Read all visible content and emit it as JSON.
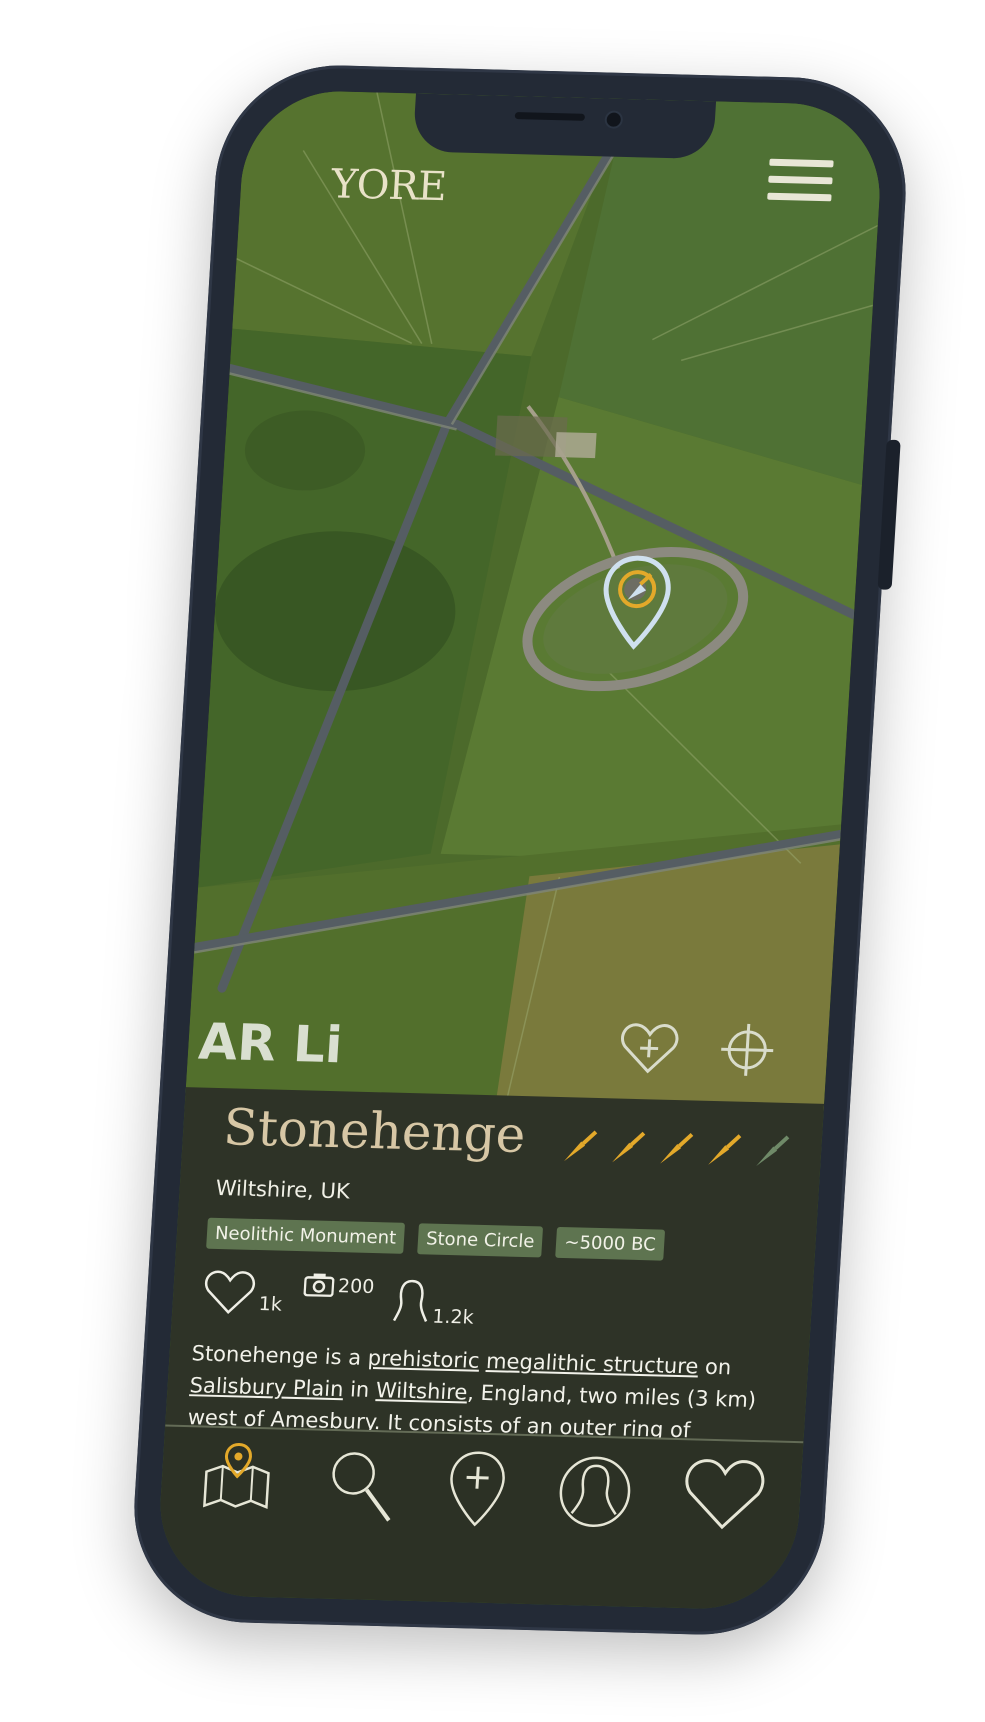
{
  "app": {
    "logo_text": "YORE"
  },
  "map": {
    "ar_label": "AR Li"
  },
  "place": {
    "name": "Stonehenge",
    "region": "Wiltshire, UK",
    "rating": 4,
    "rating_max": 5,
    "tags": [
      "Neolithic Monument",
      "Stone Circle",
      "~5000 BC"
    ],
    "stats": {
      "likes": "1k",
      "photos": "200",
      "visitors": "1.2k"
    },
    "description": {
      "p1": "Stonehenge is a ",
      "l1": "prehistoric",
      "p2": " ",
      "l2": "megalithic structure",
      "p3": " on ",
      "l3": "Salisbury Plain",
      "p4": " in ",
      "l4": "Wiltshire",
      "p5": ", England, two miles (3 km) west of ",
      "l5": "Amesbury",
      "p6": ". It consists of an outer ring of"
    }
  },
  "colors": {
    "accent": "#e3a92a",
    "panel": "#2e3327",
    "tag": "#5e7450",
    "title": "#d7c7a5"
  },
  "icons": {
    "menu": "hamburger-icon",
    "pin": "location-pin-icon",
    "favorite_add": "heart-plus-icon",
    "locate": "crosshair-icon",
    "rating": "trowel-icon",
    "likes": "heart-icon",
    "photos": "camera-icon",
    "visitors": "person-icon",
    "tabs": [
      "map-icon",
      "search-icon",
      "add-pin-icon",
      "profile-icon",
      "heart-icon"
    ]
  }
}
